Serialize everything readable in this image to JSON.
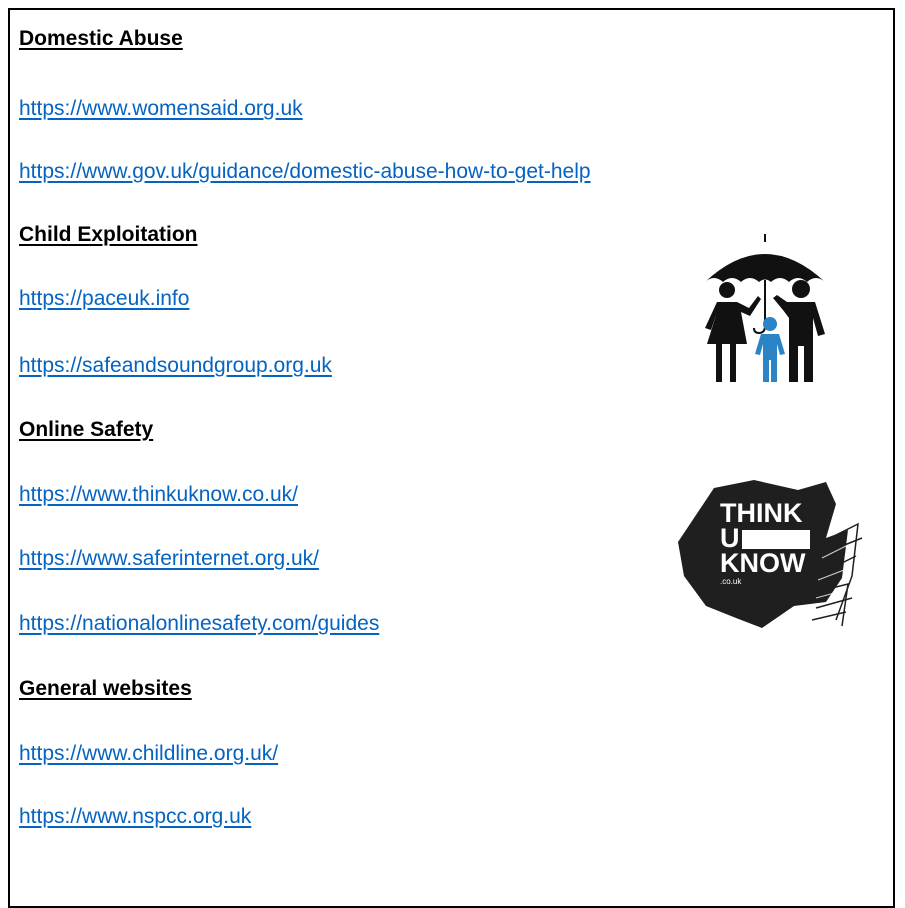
{
  "sections": [
    {
      "heading": "Domestic Abuse",
      "links": [
        "https://www.womensaid.org.uk",
        "https://www.gov.uk/guidance/domestic-abuse-how-to-get-help"
      ]
    },
    {
      "heading": "Child Exploitation",
      "links": [
        "https://paceuk.info",
        "https://safeandsoundgroup.org.uk"
      ]
    },
    {
      "heading": "Online Safety",
      "links": [
        "https://www.thinkuknow.co.uk/",
        "https://www.saferinternet.org.uk/",
        "https://nationalonlinesafety.com/guides"
      ]
    },
    {
      "heading": "General websites",
      "links": [
        "https://www.childline.org.uk/",
        "https://www.nspcc.org.uk"
      ]
    }
  ],
  "logos": {
    "umbrella_family": {
      "icon": "umbrella-family-icon",
      "colors": {
        "dark": "#111111",
        "child": "#2b84c6"
      }
    },
    "thinkuknow": {
      "icon": "thinkuknow-logo",
      "line1": "THINK",
      "line2": "U",
      "line3": "KNOW",
      "line4": ".co.uk"
    }
  },
  "colors": {
    "link": "#0563c1",
    "heading": "#000000",
    "border": "#000000"
  }
}
